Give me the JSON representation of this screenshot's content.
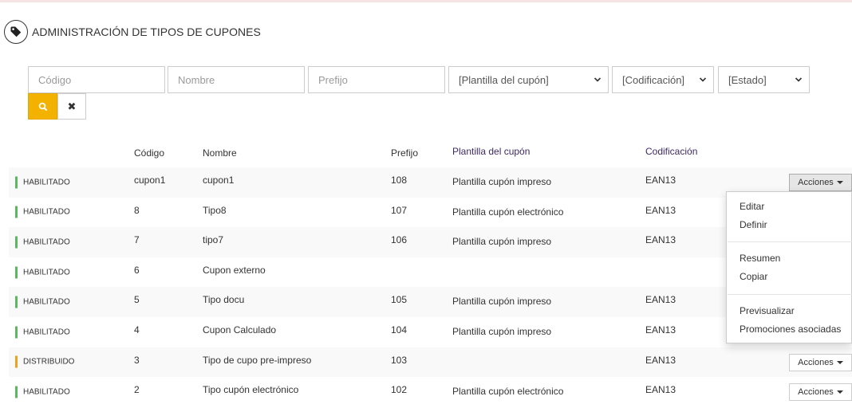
{
  "header": {
    "title": "ADMINISTRACIÓN DE TIPOS DE CUPONES",
    "icon": "tag-icon"
  },
  "filters": {
    "codigo_placeholder": "Código",
    "nombre_placeholder": "Nombre",
    "prefijo_placeholder": "Prefijo",
    "plantilla_selected": "[Plantilla del cupón]",
    "codificacion_selected": "[Codificación]",
    "estado_selected": "[Estado]",
    "search_icon": "search-icon",
    "clear_label": "✖"
  },
  "table": {
    "columns": {
      "codigo": "Código",
      "nombre": "Nombre",
      "prefijo": "Prefijo",
      "plantilla": "Plantilla del cupón",
      "codificacion": "Codificación"
    },
    "rows": [
      {
        "estado": "HABILITADO",
        "codigo": "cupon1",
        "nombre": "cupon1",
        "prefijo": "108",
        "plantilla": "Plantilla cupón impreso",
        "codificacion": "EAN13"
      },
      {
        "estado": "HABILITADO",
        "codigo": "8",
        "nombre": "Tipo8",
        "prefijo": "107",
        "plantilla": "Plantilla cupón electrónico",
        "codificacion": "EAN13"
      },
      {
        "estado": "HABILITADO",
        "codigo": "7",
        "nombre": "tipo7",
        "prefijo": "106",
        "plantilla": "Plantilla cupón impreso",
        "codificacion": "EAN13"
      },
      {
        "estado": "HABILITADO",
        "codigo": "6",
        "nombre": "Cupon externo",
        "prefijo": "",
        "plantilla": "",
        "codificacion": ""
      },
      {
        "estado": "HABILITADO",
        "codigo": "5",
        "nombre": "Tipo docu",
        "prefijo": "105",
        "plantilla": "Plantilla cupón impreso",
        "codificacion": "EAN13"
      },
      {
        "estado": "HABILITADO",
        "codigo": "4",
        "nombre": "Cupon Calculado",
        "prefijo": "104",
        "plantilla": "Plantilla cupón impreso",
        "codificacion": "EAN13"
      },
      {
        "estado": "DISTRIBUIDO",
        "codigo": "3",
        "nombre": "Tipo de cupo pre-impreso",
        "prefijo": "103",
        "plantilla": "",
        "codificacion": "EAN13"
      },
      {
        "estado": "HABILITADO",
        "codigo": "2",
        "nombre": "Tipo cupón electrónico",
        "prefijo": "102",
        "plantilla": "Plantilla cupón electrónico",
        "codificacion": "EAN13"
      }
    ],
    "actions_label": "Acciones"
  },
  "actions_menu": {
    "items": [
      "Editar",
      "Definir",
      "Resumen",
      "Copiar",
      "Previsualizar",
      "Promociones asociadas"
    ]
  },
  "colors": {
    "accent": "#f3b200",
    "status_habilitado": "#5cb85c",
    "status_distribuido": "#f0a020"
  }
}
